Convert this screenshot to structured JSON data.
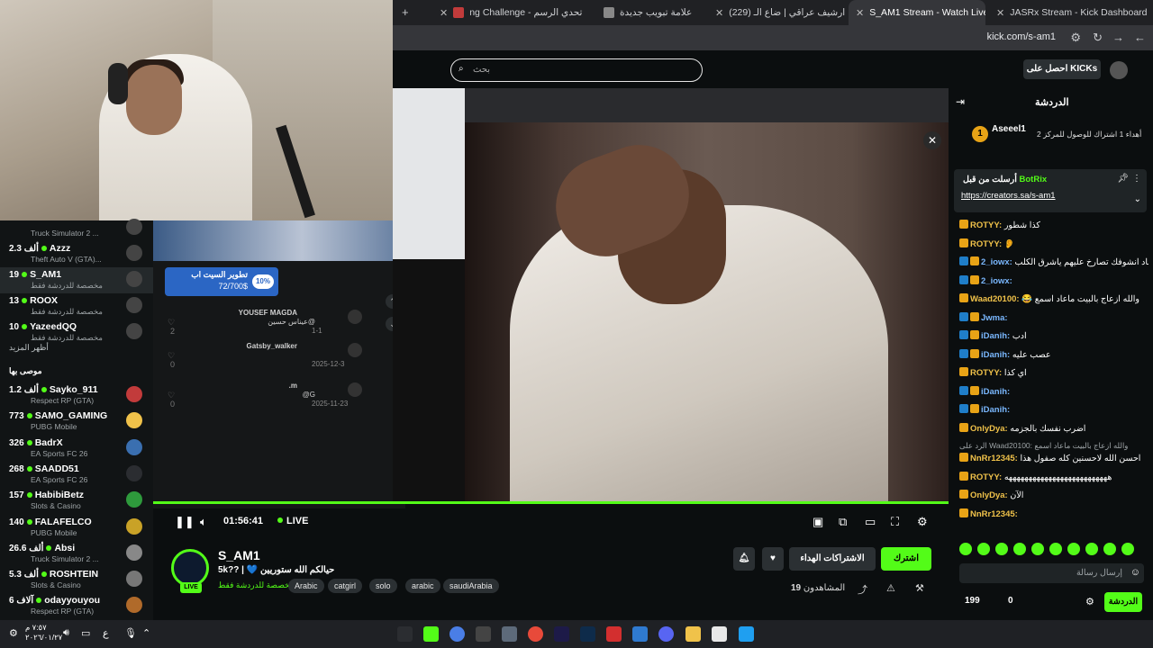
{
  "browser": {
    "tabs": [
      {
        "label": "ng Challenge - تحدي الرسم",
        "color": "#c23b3b"
      },
      {
        "label": "علامة تبويب جديدة",
        "color": "#888888"
      },
      {
        "label": "(229) ارشيف عراقي | ضاع الـ",
        "color": "#ff0000"
      },
      {
        "label": "S_AM1 Stream - Watch Live",
        "color": "#53fc18",
        "active": true
      },
      {
        "label": "JASRx Stream - Kick Dashboard",
        "color": "#53fc18"
      }
    ],
    "url": "kick.com/s-am1"
  },
  "kick_header": {
    "search_placeholder": "بحث",
    "get_kicks": "احصل على KICKs"
  },
  "sidebar": {
    "channels_top": [
      {
        "count": "",
        "name": "",
        "category": "Truck Simulator 2 ...",
        "sel": false
      },
      {
        "count": "2.3 ألف",
        "name": "Azzz",
        "category": "Theft Auto V (GTA)...",
        "sel": false
      },
      {
        "count": "19",
        "name": "S_AM1",
        "category": "مخصصة للدردشة فقط",
        "sel": true
      },
      {
        "count": "13",
        "name": "ROOX",
        "category": "مخصصة للدردشة فقط",
        "sel": false
      },
      {
        "count": "10",
        "name": "YazeedQQ",
        "category": "مخصصة للدردشة فقط",
        "sel": false
      }
    ],
    "show_more": "أظهر المزيد",
    "recommended_title": "موصى بها",
    "channels_rec": [
      {
        "count": "1.2 ألف",
        "name": "Sayko_911",
        "category": "Respect RP (GTA)"
      },
      {
        "count": "773",
        "name": "SAMO_GAMING",
        "category": "PUBG Mobile"
      },
      {
        "count": "326",
        "name": "BadrX",
        "category": "EA Sports FC 26"
      },
      {
        "count": "268",
        "name": "SAADD51",
        "category": "EA Sports FC 26"
      },
      {
        "count": "157",
        "name": "HabibiBetz",
        "category": "Slots & Casino"
      },
      {
        "count": "140",
        "name": "FALAFELCO",
        "category": "PUBG Mobile"
      },
      {
        "count": "26.6 ألف",
        "name": "Absi",
        "category": "Truck Simulator 2 ..."
      },
      {
        "count": "5.3 ألف",
        "name": "ROSHTEIN",
        "category": "Slots & Casino"
      },
      {
        "count": "6 آلاف",
        "name": "odayyouyou",
        "category": "Respect RP (GTA)"
      }
    ]
  },
  "tiktok": {
    "goal_title": "تطوير السيت اب",
    "goal_value": "72/700$",
    "goal_percent": "10%",
    "goal_fraction": 0.1,
    "comments": [
      {
        "user": "YOUSEF MAGDA",
        "text": "عيناس حسين@",
        "date": "1-1"
      },
      {
        "user": "Gatsby_walker",
        "text": "",
        "date": "2025-12-3"
      },
      {
        "user": ".m",
        "text": "@G",
        "date": "2025-11-23"
      }
    ],
    "likes": [
      "2",
      "0",
      "0"
    ]
  },
  "player": {
    "time": "01:56:41",
    "live": "LIVE"
  },
  "stream": {
    "streamer": "S_AM1",
    "title": "5k?? | 💙 حيالكم الله ستوريين",
    "category": "مخصصة للدردشة فقط",
    "live_badge": "LIVE",
    "tags": [
      "Arabic",
      "catgirl",
      "solo",
      "arabic",
      "saudiArabia"
    ],
    "subscribe": "اشترك",
    "gift_subs": "الاشتراكات الهداء",
    "viewers_label": "المشاهدون",
    "viewers": "19"
  },
  "chat": {
    "title": "الدردشة",
    "top_gifter_name": "Aseeel1",
    "top_gifter_rank": "1",
    "top_gifter_text": "أهداء 1 اشتراك للوصول للمركز 2",
    "pinned_by": "BotRix",
    "pinned_label": "أرسلت من قبل",
    "pinned_link": "https://creators.sa/s-am1",
    "messages": [
      {
        "user": "ROTYY:",
        "text": "كذا شطور",
        "b": 1
      },
      {
        "user": "ROTYY:",
        "text": "👂",
        "b": 1
      },
      {
        "user": "2_iowx:",
        "text": "اي ذكاب ولا عاد انشوفك تصارخ عليهم ياشرق الكلب",
        "b": 2
      },
      {
        "user": "2_iowx:",
        "text": "",
        "b": 2
      },
      {
        "user": "Waad20100:",
        "text": "😂 والله ازعاج بالبيت ماعاد اسمع",
        "b": 1
      },
      {
        "user": "Jwma:",
        "text": "",
        "b": 2
      },
      {
        "user": "iDanih:",
        "text": "ادب",
        "b": 2
      },
      {
        "user": "iDanih:",
        "text": "عصب عليه",
        "b": 2
      },
      {
        "user": "ROTYY:",
        "text": "اي كذا",
        "b": 1
      },
      {
        "user": "iDanih:",
        "text": "",
        "b": 2
      },
      {
        "user": "iDanih:",
        "text": "",
        "b": 2
      },
      {
        "user": "OnlyDya:",
        "text": "اضرب نفسك بالجزمه",
        "b": 1
      },
      {
        "user": "",
        "text": "الرد على Waad20100: والله ازعاج بالبيت ماعاد اسمع",
        "b": 0
      },
      {
        "user": "NnRr12345:",
        "text": "احسن الله لاحسنين كله صفول هذا",
        "b": 1
      },
      {
        "user": "ROTYY:",
        "text": "ههههههههههههههههههههههههههه",
        "b": 1
      },
      {
        "user": "OnlyDya:",
        "text": "الآن",
        "b": 1
      },
      {
        "user": "NnRr12345:",
        "text": "",
        "b": 1
      }
    ],
    "input_placeholder": "إرسال رسالة",
    "kicks_count": "199",
    "zero": "0",
    "send": "الدردشة"
  },
  "taskbar": {
    "time": "٧:٥٧ م",
    "date": "٢٠٢٦/٠١/٢٧",
    "lang": "ع"
  }
}
